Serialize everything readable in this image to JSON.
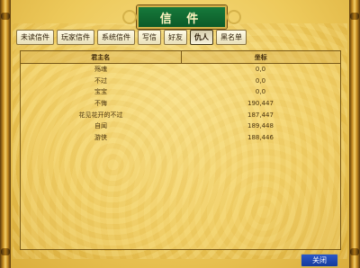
{
  "window": {
    "title": "信 件"
  },
  "tabs": [
    {
      "label": "未读信件",
      "active": false
    },
    {
      "label": "玩家信件",
      "active": false
    },
    {
      "label": "系统信件",
      "active": false
    },
    {
      "label": "写信",
      "active": false
    },
    {
      "label": "好友",
      "active": false
    },
    {
      "label": "仇人",
      "active": true
    },
    {
      "label": "黑名单",
      "active": false
    }
  ],
  "table": {
    "headers": {
      "name": "君主名",
      "coord": "坐标"
    },
    "rows": [
      {
        "name": "殇魂",
        "coord": "0,0"
      },
      {
        "name": "不过",
        "coord": "0,0"
      },
      {
        "name": "宝宝",
        "coord": "0,0"
      },
      {
        "name": "不悔",
        "coord": "190,447"
      },
      {
        "name": "花见花开的不过",
        "coord": "187,447"
      },
      {
        "name": "自闻",
        "coord": "189,448"
      },
      {
        "name": "游侠",
        "coord": "188,446"
      }
    ]
  },
  "buttons": {
    "close": "关闭"
  },
  "colors": {
    "title_bg": "#16793b",
    "close_bg": "#2b57c7",
    "panel": "#edc95a"
  }
}
